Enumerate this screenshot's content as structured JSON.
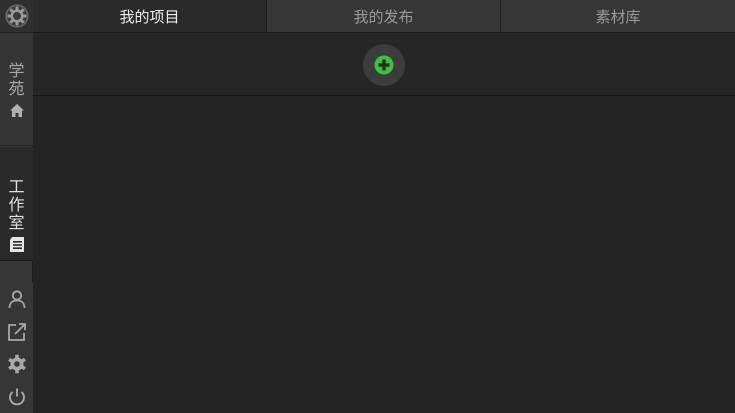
{
  "sidebar": {
    "logo_icon": "gear-logo-icon",
    "academy": {
      "label": "学苑",
      "icon": "home-icon"
    },
    "studio": {
      "label": "工作室",
      "icon": "document-icon"
    },
    "tools": [
      {
        "icon": "user-icon"
      },
      {
        "icon": "external-link-icon"
      },
      {
        "icon": "settings-icon"
      },
      {
        "icon": "power-icon"
      }
    ]
  },
  "tabs": [
    {
      "label": "我的项目",
      "active": true
    },
    {
      "label": "我的发布",
      "active": false
    },
    {
      "label": "素材库",
      "active": false
    }
  ],
  "main": {
    "add_icon": "add-circle-icon"
  },
  "colors": {
    "accent": "#3cc43c",
    "background": "#242424",
    "sidebar": "#363636",
    "tab_active_text": "#ececec",
    "tab_inactive_text": "#9a9a9a"
  }
}
